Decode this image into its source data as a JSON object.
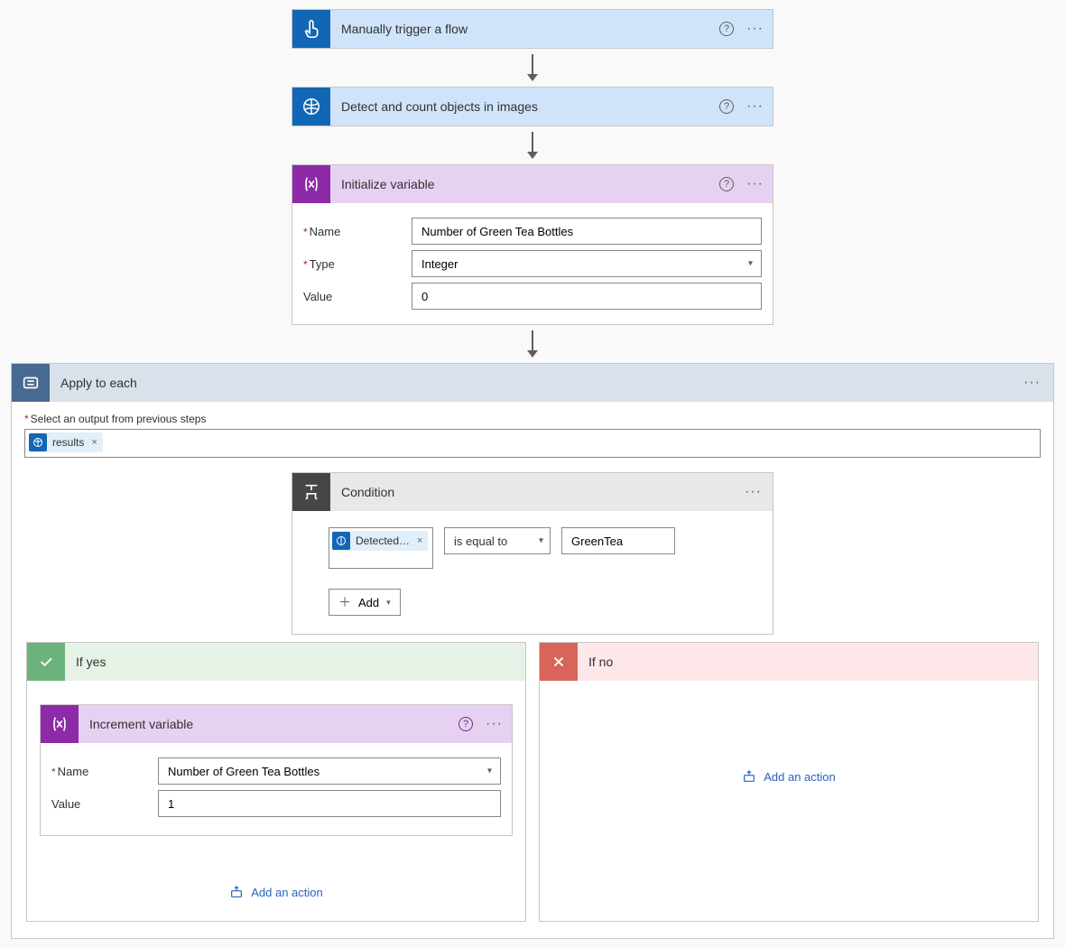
{
  "steps": {
    "trigger": {
      "title": "Manually trigger a flow"
    },
    "detect": {
      "title": "Detect and count objects in images"
    },
    "initVar": {
      "title": "Initialize variable",
      "fields": {
        "name_label": "Name",
        "name_value": "Number of Green Tea Bottles",
        "type_label": "Type",
        "type_value": "Integer",
        "value_label": "Value",
        "value_value": "0"
      }
    }
  },
  "applyToEach": {
    "title": "Apply to each",
    "select_label": "Select an output from previous steps",
    "token": "results"
  },
  "condition": {
    "title": "Condition",
    "left_token": "Detected…",
    "operator": "is equal to",
    "right_value": "GreenTea",
    "add_label": "Add"
  },
  "branches": {
    "yes": {
      "title": "If yes",
      "incrementVar": {
        "title": "Increment variable",
        "name_label": "Name",
        "name_value": "Number of Green Tea Bottles",
        "value_label": "Value",
        "value_value": "1"
      },
      "add_action": "Add an action"
    },
    "no": {
      "title": "If no",
      "add_action": "Add an action"
    }
  }
}
